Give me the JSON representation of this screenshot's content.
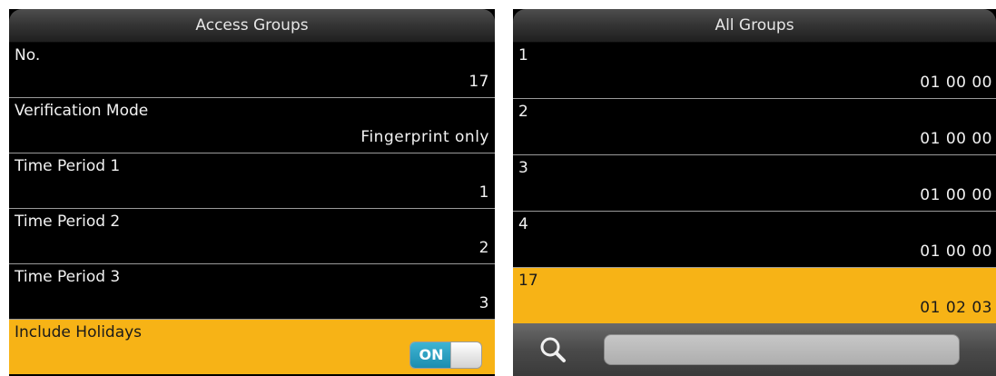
{
  "left_panel": {
    "title": "Access Groups",
    "rows": [
      {
        "label": "No.",
        "value": "17"
      },
      {
        "label": "Verification Mode",
        "value": "Fingerprint only"
      },
      {
        "label": "Time Period 1",
        "value": "1"
      },
      {
        "label": "Time Period 2",
        "value": "2"
      },
      {
        "label": "Time Period 3",
        "value": "3"
      }
    ],
    "holidays": {
      "label": "Include Holidays",
      "toggle_label": "ON"
    }
  },
  "right_panel": {
    "title": "All Groups",
    "rows": [
      {
        "label": "1",
        "value": "01 00 00"
      },
      {
        "label": "2",
        "value": "01 00 00"
      },
      {
        "label": "3",
        "value": "01 00 00"
      },
      {
        "label": "4",
        "value": "01 00 00"
      },
      {
        "label": "17",
        "value": "01 02 03"
      }
    ],
    "search": {
      "value": "",
      "placeholder": ""
    }
  },
  "colors": {
    "highlight": "#f7b316",
    "toggle_on": "#1c8db0",
    "background": "#000000"
  },
  "icons": {
    "search": "magnifier-icon"
  }
}
